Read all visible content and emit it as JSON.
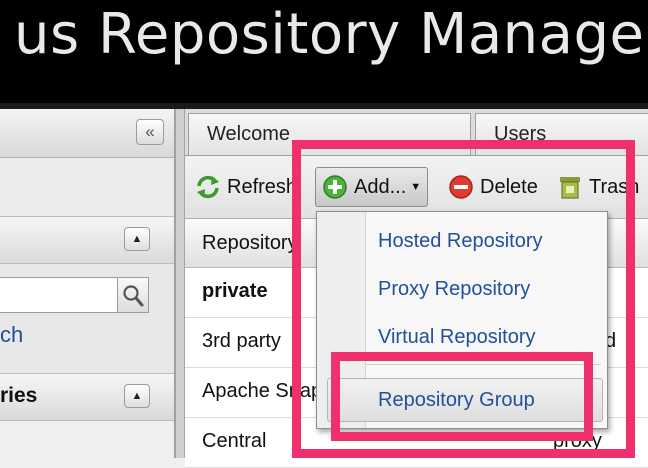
{
  "header": {
    "title": "us Repository Manager O"
  },
  "left_panel": {
    "collapse_label": "«",
    "search": {
      "value": "",
      "link_text": "ch"
    },
    "section_title": "ries"
  },
  "tabs": [
    {
      "label": "Welcome"
    },
    {
      "label": "Users"
    }
  ],
  "toolbar": {
    "refresh_label": "Refresh",
    "add_label": "Add...",
    "delete_label": "Delete",
    "trash_label": "Trash"
  },
  "grid": {
    "column_header": "Repository",
    "rows": [
      {
        "name": "private",
        "type": ""
      },
      {
        "name": "3rd party",
        "type": "d"
      },
      {
        "name": "Apache Snapshots",
        "type": ""
      },
      {
        "name": "Central",
        "type": "proxy"
      }
    ]
  },
  "add_menu": {
    "items": [
      {
        "label": "Hosted Repository"
      },
      {
        "label": "Proxy Repository"
      },
      {
        "label": "Virtual Repository"
      },
      {
        "label": "Repository Group"
      }
    ]
  },
  "colors": {
    "highlight": "#f0306c",
    "link": "#23509a",
    "header_bg": "#000000"
  }
}
